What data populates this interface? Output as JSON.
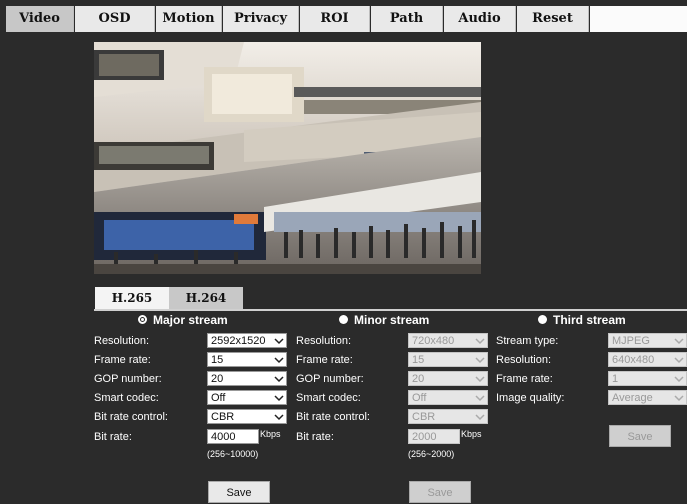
{
  "tabs": [
    "Video",
    "OSD",
    "Motion",
    "Privacy",
    "ROI",
    "Path",
    "Audio",
    "Reset"
  ],
  "codec_tabs": [
    "H.265",
    "H.264"
  ],
  "streams": {
    "major": {
      "title": "Major stream",
      "labels": {
        "resolution": "Resolution:",
        "frame_rate": "Frame rate:",
        "gop": "GOP number:",
        "smart_codec": "Smart codec:",
        "bitrate_control": "Bit rate control:",
        "bitrate": "Bit rate:"
      },
      "values": {
        "resolution": "2592x1520",
        "frame_rate": "15",
        "gop": "20",
        "smart_codec": "Off",
        "bitrate_control": "CBR",
        "bitrate": "4000"
      },
      "unit": "Kbps",
      "range": "(256~10000)",
      "save": "Save"
    },
    "minor": {
      "title": "Minor stream",
      "labels": {
        "resolution": "Resolution:",
        "frame_rate": "Frame rate:",
        "gop": "GOP number:",
        "smart_codec": "Smart codec:",
        "bitrate_control": "Bit rate control:",
        "bitrate": "Bit rate:"
      },
      "values": {
        "resolution": "720x480",
        "frame_rate": "15",
        "gop": "20",
        "smart_codec": "Off",
        "bitrate_control": "CBR",
        "bitrate": "2000"
      },
      "unit": "Kbps",
      "range": "(256~2000)",
      "save": "Save"
    },
    "third": {
      "title": "Third stream",
      "labels": {
        "stream_type": "Stream type:",
        "resolution": "Resolution:",
        "frame_rate": "Frame rate:",
        "image_quality": "Image quality:"
      },
      "values": {
        "stream_type": "MJPEG",
        "resolution": "640x480",
        "frame_rate": "1",
        "image_quality": "Average"
      },
      "save": "Save"
    }
  },
  "colors": {
    "background": "#2b2b2b",
    "tab_bg": "#e9e9e9",
    "tab_active": "#c7c7c7"
  }
}
